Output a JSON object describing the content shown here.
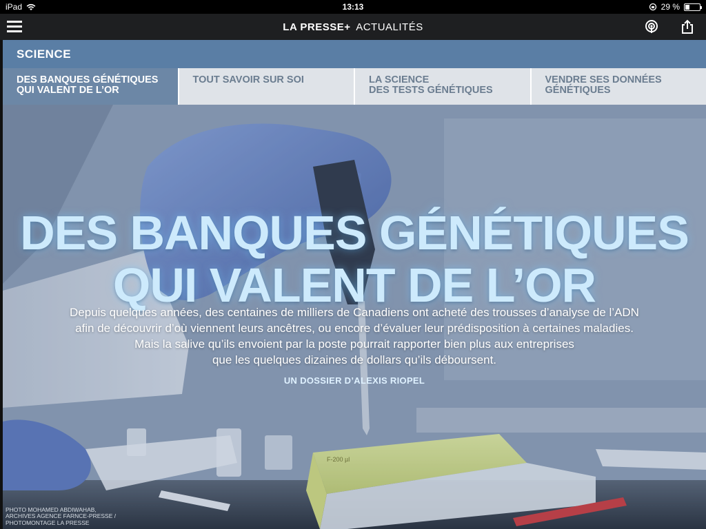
{
  "status_bar": {
    "device": "iPad",
    "time": "13:13",
    "battery": "29 %",
    "battery_level": 0.29
  },
  "app_bar": {
    "brand": "LA PRESSE+",
    "section": "ACTUALITÉS"
  },
  "section": {
    "title": "SCIENCE"
  },
  "tabs": [
    {
      "line1": "DES BANQUES GÉNÉTIQUES",
      "line2": "QUI VALENT DE L’OR",
      "active": true
    },
    {
      "line1": "TOUT SAVOIR SUR SOI",
      "line2": "",
      "active": false
    },
    {
      "line1": "LA SCIENCE",
      "line2": "DES TESTS GÉNÉTIQUES",
      "active": false
    },
    {
      "line1": "VENDRE SES DONNÉES",
      "line2": "GÉNÉTIQUES",
      "active": false
    }
  ],
  "hero": {
    "headline_line1": "DES BANQUES GÉNÉTIQUES",
    "headline_line2": "QUI VALENT DE L’OR",
    "dek_lines": [
      "Depuis quelques années, des centaines de milliers de Canadiens ont acheté des trousses d’analyse de l’ADN",
      "afin de découvrir d’où viennent leurs ancêtres, ou encore d’évaluer leur prédisposition à certaines maladies.",
      "Mais la salive qu’ils envoient par la poste pourrait rapporter bien plus aux entreprises",
      "que les quelques dizaines de dollars qu’ils déboursent."
    ],
    "byline": "UN DOSSIER D’ALEXIS RIOPEL",
    "credit_lines": [
      "PHOTO MOHAMED ABDIWAHAB,",
      "ARCHIVES AGENCE FARNCE-PRESSE /",
      "PHOTOMONTAGE LA PRESSE"
    ],
    "tip_label": "F-200 µl"
  },
  "icons": {
    "menu": "hamburger-menu-icon",
    "podcast": "podcast-icon",
    "share": "share-icon",
    "wifi": "wifi-icon",
    "battery": "battery-icon"
  },
  "colors": {
    "section_header": "#5a7ea5",
    "tab_active": "#6c87a6",
    "tab_inactive": "#dfe3e8",
    "headline": "#cdeafc"
  }
}
